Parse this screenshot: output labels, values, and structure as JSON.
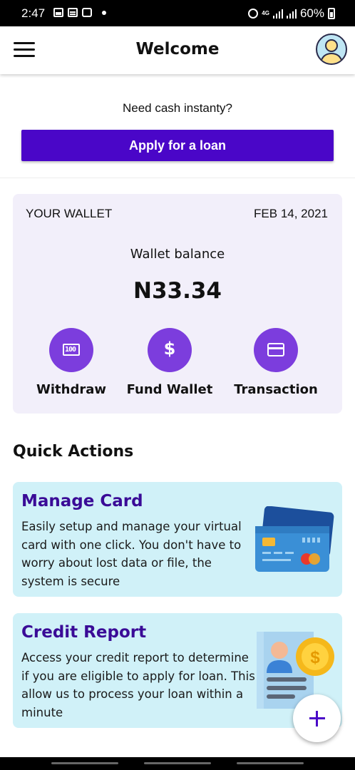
{
  "status_bar": {
    "time": "2:47",
    "network": "4G",
    "battery": "60%",
    "icons_left": [
      "gallery-icon",
      "document-icon",
      "tv-icon"
    ],
    "icons_right": [
      "alarm-icon",
      "network-icon",
      "signal-icon",
      "battery-icon"
    ]
  },
  "header": {
    "title": "Welcome",
    "menu_icon": "hamburger-menu-icon",
    "avatar_icon": "user-avatar-icon"
  },
  "loan": {
    "prompt": "Need cash instanty?",
    "button_label": "Apply for a loan",
    "button_color": "#4a06c8"
  },
  "wallet": {
    "label": "YOUR WALLET",
    "date": "FEB 14, 2021",
    "balance_label": "Wallet balance",
    "balance": "N33.34",
    "card_color": "#f2effa",
    "action_color": "#7c3ddd",
    "actions": [
      {
        "label": "Withdraw",
        "icon": "cash-icon"
      },
      {
        "label": "Fund Wallet",
        "icon": "dollar-icon"
      },
      {
        "label": "Transaction",
        "icon": "credit-card-icon"
      }
    ]
  },
  "quick_actions": {
    "title": "Quick Actions",
    "card_color": "#d0f1f8",
    "heading_color": "#3a0b97",
    "cards": [
      {
        "title": "Manage Card",
        "description": "Easily setup and manage your virtual card with one click. You don't have to worry about lost data or file, the system is secure",
        "icon": "credit-cards-illustration-icon"
      },
      {
        "title": "Credit Report",
        "description": "Access your credit report to determine if you are eligible to apply for loan. This allow us to process your loan within a minute",
        "icon": "credit-report-illustration-icon"
      }
    ]
  },
  "fab": {
    "icon": "plus-icon"
  }
}
